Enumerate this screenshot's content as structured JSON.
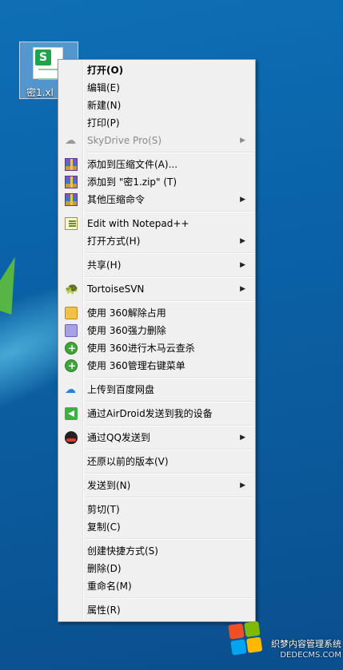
{
  "desktop": {
    "file_icon_badge": "S",
    "file_label": "密1.xl"
  },
  "menu": {
    "items": [
      {
        "label": "打开(O)",
        "bold": true
      },
      {
        "label": "编辑(E)"
      },
      {
        "label": "新建(N)"
      },
      {
        "label": "打印(P)"
      },
      {
        "label": "SkyDrive Pro(S)",
        "disabled": true,
        "submenu": true,
        "icon": "cloud-icon"
      },
      {
        "label": "添加到压缩文件(A)...",
        "icon": "winrar-icon"
      },
      {
        "label": "添加到 \"密1.zip\" (T)",
        "icon": "winrar-icon"
      },
      {
        "label": "其他压缩命令",
        "submenu": true,
        "icon": "winrar-icon"
      },
      {
        "label": "Edit with Notepad++",
        "icon": "notepadpp-icon"
      },
      {
        "label": "打开方式(H)",
        "submenu": true
      },
      {
        "label": "共享(H)",
        "submenu": true
      },
      {
        "label": "TortoiseSVN",
        "submenu": true,
        "icon": "tortoisesvn-icon"
      },
      {
        "label": "使用 360解除占用",
        "icon": "360-unlock-icon"
      },
      {
        "label": "使用 360强力删除",
        "icon": "360-shred-icon"
      },
      {
        "label": "使用 360进行木马云查杀",
        "icon": "360-scan-icon"
      },
      {
        "label": "使用 360管理右键菜单",
        "icon": "360-scan-icon"
      },
      {
        "label": "上传到百度网盘",
        "icon": "baidu-netdisk-icon"
      },
      {
        "label": "通过AirDroid发送到我的设备",
        "icon": "airdroid-icon"
      },
      {
        "label": "通过QQ发送到",
        "submenu": true,
        "icon": "qq-icon"
      },
      {
        "label": "还原以前的版本(V)"
      },
      {
        "label": "发送到(N)",
        "submenu": true
      },
      {
        "label": "剪切(T)"
      },
      {
        "label": "复制(C)"
      },
      {
        "label": "创建快捷方式(S)"
      },
      {
        "label": "删除(D)"
      },
      {
        "label": "重命名(M)"
      },
      {
        "label": "属性(R)"
      }
    ]
  },
  "watermark": {
    "line1": "织梦内容管理系统",
    "line2": "DEDECMS.COM"
  }
}
